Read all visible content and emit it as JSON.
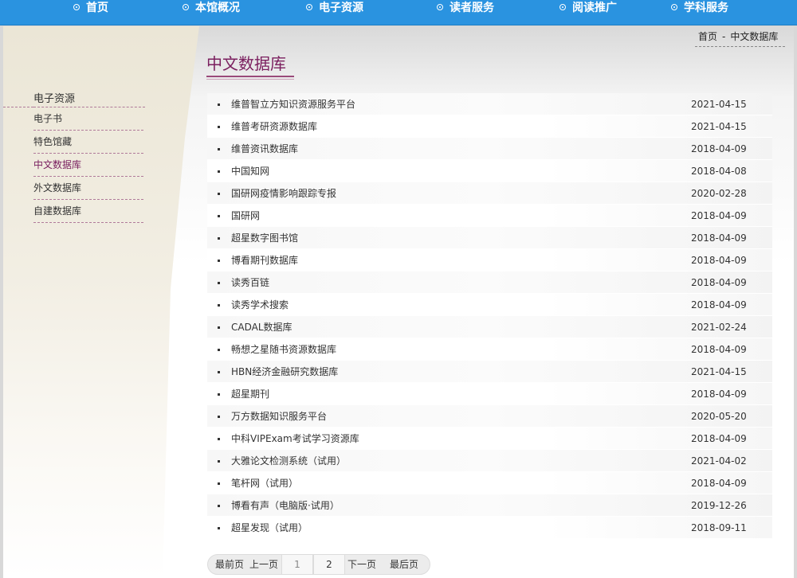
{
  "nav": {
    "items": [
      {
        "label": "首页"
      },
      {
        "label": "本馆概况"
      },
      {
        "label": "电子资源"
      },
      {
        "label": "读者服务"
      },
      {
        "label": "阅读推广"
      },
      {
        "label": "学科服务"
      }
    ]
  },
  "sidebar": {
    "title": "电子资源",
    "items": [
      {
        "label": "电子书",
        "active": false
      },
      {
        "label": "特色馆藏",
        "active": false
      },
      {
        "label": "中文数据库",
        "active": true
      },
      {
        "label": "外文数据库",
        "active": false
      },
      {
        "label": "自建数据库",
        "active": false
      }
    ]
  },
  "breadcrumb": {
    "home": "首页",
    "separator": "-",
    "current": "中文数据库"
  },
  "page_title": "中文数据库",
  "list": [
    {
      "title": "维普智立方知识资源服务平台",
      "date": "2021-04-15"
    },
    {
      "title": "维普考研资源数据库",
      "date": "2021-04-15"
    },
    {
      "title": "维普资讯数据库",
      "date": "2018-04-09"
    },
    {
      "title": "中国知网",
      "date": "2018-04-08"
    },
    {
      "title": "国研网疫情影响跟踪专报",
      "date": "2020-02-28"
    },
    {
      "title": "国研网",
      "date": "2018-04-09"
    },
    {
      "title": "超星数字图书馆",
      "date": "2018-04-09"
    },
    {
      "title": "博看期刊数据库",
      "date": "2018-04-09"
    },
    {
      "title": "读秀百链",
      "date": "2018-04-09"
    },
    {
      "title": "读秀学术搜索",
      "date": "2018-04-09"
    },
    {
      "title": "CADAL数据库",
      "date": "2021-02-24"
    },
    {
      "title": "畅想之星随书资源数据库",
      "date": "2018-04-09"
    },
    {
      "title": "HBN经济金融研究数据库",
      "date": "2021-04-15"
    },
    {
      "title": "超星期刊",
      "date": "2018-04-09"
    },
    {
      "title": "万方数据知识服务平台",
      "date": "2020-05-20"
    },
    {
      "title": "中科VIPExam考试学习资源库",
      "date": "2018-04-09"
    },
    {
      "title": "大雅论文检测系统（试用）",
      "date": "2021-04-02"
    },
    {
      "title": "笔杆网（试用）",
      "date": "2018-04-09"
    },
    {
      "title": "博看有声（电脑版·试用）",
      "date": "2019-12-26"
    },
    {
      "title": "超星发现（试用）",
      "date": "2018-09-11"
    }
  ],
  "pager": {
    "first": "最前页",
    "prev": "上一页",
    "pages": [
      "1",
      "2"
    ],
    "current": "1",
    "next": "下一页",
    "last": "最后页"
  }
}
